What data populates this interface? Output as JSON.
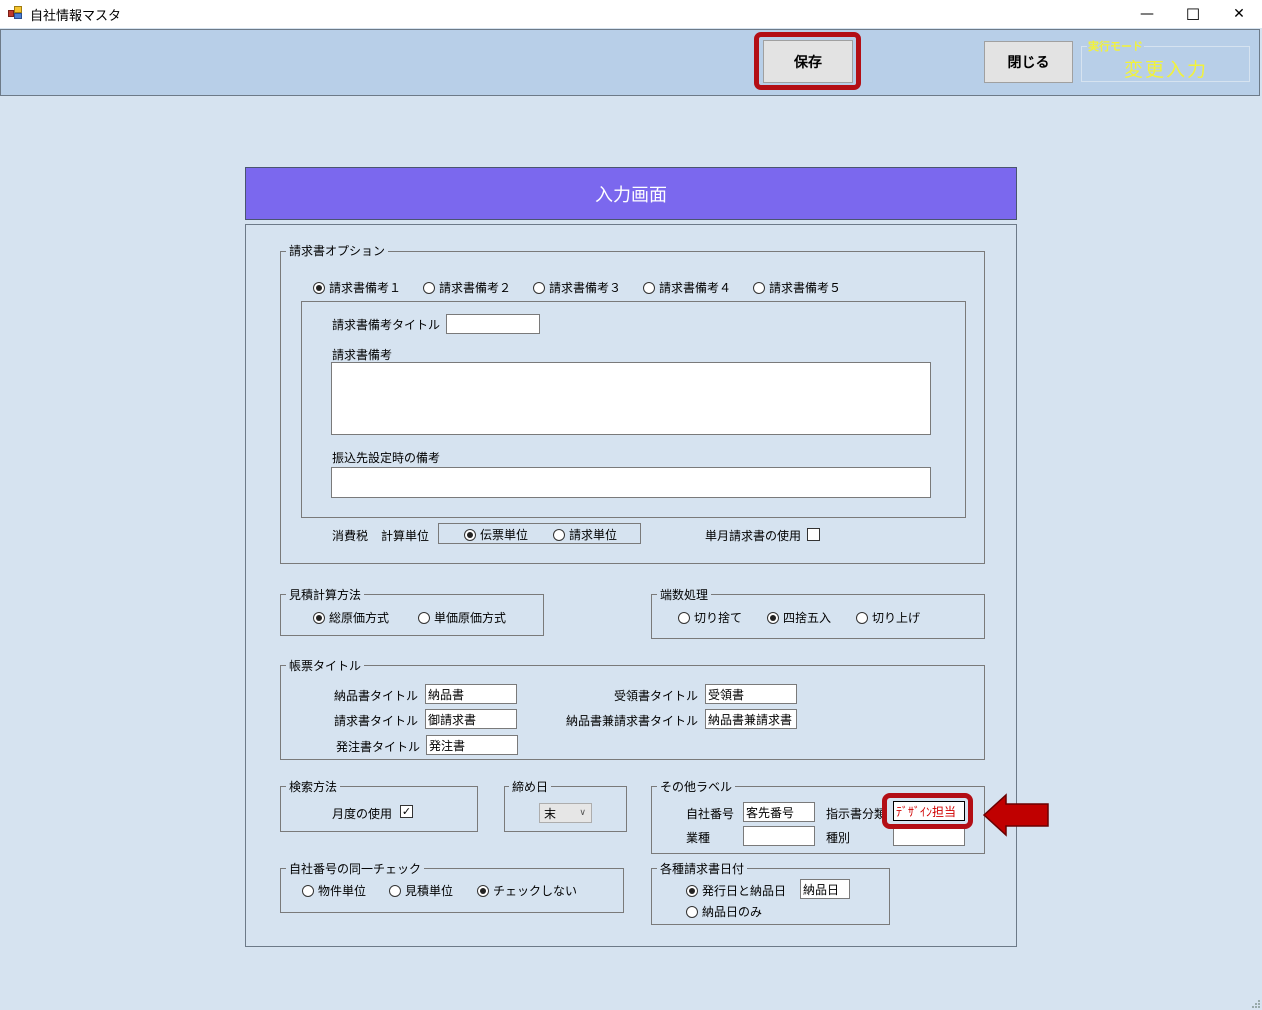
{
  "window": {
    "title": "自社情報マスタ",
    "controls": {
      "minimize": "—",
      "maximize": "☐",
      "close": "✕"
    }
  },
  "toolbar": {
    "save_label": "保存",
    "close_label": "閉じる",
    "mode_label": "実行モード",
    "mode_value": "変更入力"
  },
  "header": {
    "title": "入力画面"
  },
  "invoice_options": {
    "group_label": "請求書オプション",
    "remark_tabs": [
      {
        "label": "請求書備考１",
        "selected": true
      },
      {
        "label": "請求書備考２",
        "selected": false
      },
      {
        "label": "請求書備考３",
        "selected": false
      },
      {
        "label": "請求書備考４",
        "selected": false
      },
      {
        "label": "請求書備考５",
        "selected": false
      }
    ],
    "remark_title_label": "請求書備考タイトル",
    "remark_title_value": "",
    "remark_label": "請求書備考",
    "remark_value": "",
    "transfer_remark_label": "振込先設定時の備考",
    "transfer_remark_value": "",
    "tax_label": "消費税",
    "calc_unit_label": "計算単位",
    "calc_unit_options": [
      {
        "label": "伝票単位",
        "selected": true
      },
      {
        "label": "請求単位",
        "selected": false
      }
    ],
    "single_month_label": "単月請求書の使用",
    "single_month_checked": false
  },
  "estimate_method": {
    "group_label": "見積計算方法",
    "options": [
      {
        "label": "総原価方式",
        "selected": true
      },
      {
        "label": "単価原価方式",
        "selected": false
      }
    ]
  },
  "rounding": {
    "group_label": "端数処理",
    "options": [
      {
        "label": "切り捨て",
        "selected": false
      },
      {
        "label": "四捨五入",
        "selected": true
      },
      {
        "label": "切り上げ",
        "selected": false
      }
    ]
  },
  "form_titles": {
    "group_label": "帳票タイトル",
    "fields": [
      {
        "label": "納品書タイトル",
        "value": "納品書"
      },
      {
        "label": "請求書タイトル",
        "value": "御請求書"
      },
      {
        "label": "発注書タイトル",
        "value": "発注書"
      },
      {
        "label": "受領書タイトル",
        "value": "受領書"
      },
      {
        "label": "納品書兼請求書タイトル",
        "value": "納品書兼請求書"
      }
    ]
  },
  "search_method": {
    "group_label": "検索方法",
    "month_use_label": "月度の使用",
    "month_use_checked": true
  },
  "closing_day": {
    "group_label": "締め日",
    "selected": "末"
  },
  "other_labels": {
    "group_label": "その他ラベル",
    "fields": [
      {
        "label": "自社番号",
        "value": "客先番号"
      },
      {
        "label": "指示書分類",
        "value": "ﾃﾞｻﾞｲﾝ担当"
      },
      {
        "label": "業種",
        "value": ""
      },
      {
        "label": "種別",
        "value": ""
      }
    ]
  },
  "number_check": {
    "group_label": "自社番号の同一チェック",
    "options": [
      {
        "label": "物件単位",
        "selected": false
      },
      {
        "label": "見積単位",
        "selected": false
      },
      {
        "label": "チェックしない",
        "selected": true
      }
    ]
  },
  "invoice_date": {
    "group_label": "各種請求書日付",
    "options": [
      {
        "label": "発行日と納品日",
        "selected": true
      },
      {
        "label": "納品日のみ",
        "selected": false
      }
    ],
    "delivery_label_value": "納品日"
  },
  "colors": {
    "header_bg": "#7b68ee",
    "toolbar_bg": "#b8cfe8",
    "page_bg": "#d6e3f0",
    "highlight": "#b30e15",
    "mode_text": "#f2f23a",
    "edited_text": "#d00000"
  }
}
